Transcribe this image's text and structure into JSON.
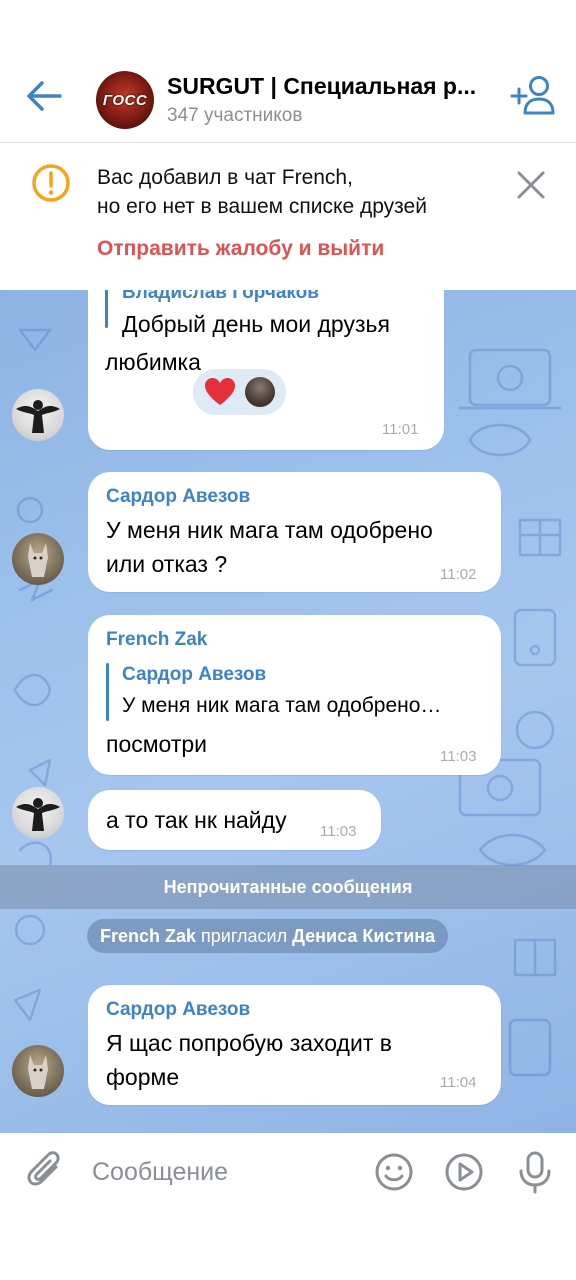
{
  "header": {
    "title": "SURGUT | Специальная р...",
    "subtitle": "347 участников",
    "avatar_text": "ГОСС"
  },
  "notice": {
    "line1": "Вас добавил в чат French,",
    "line2": "но его нет в вашем списке друзей",
    "action": "Отправить жалобу и выйти"
  },
  "messages": [
    {
      "quote_name": "Владислав Горчаков",
      "text_line1": "Добрый день мои друзья",
      "text_line2": "любимка",
      "reaction": "heart",
      "time": "11:01"
    },
    {
      "sender": "Сардор Авезов",
      "text_line1": "У меня ник мага там одобрено",
      "text_line2": "или отказ ?",
      "time": "11:02"
    },
    {
      "sender": "French Zak",
      "quote_name": "Сардор Авезов",
      "quote_text": "У меня ник мага там одобрено…",
      "text": "посмотри",
      "time": "11:03"
    },
    {
      "text": "а то так нк найду",
      "time": "11:03"
    },
    {
      "sender": "Сардор Авезов",
      "text_line1": "Я щас попробую заходит в",
      "text_line2": "форме",
      "time": "11:04"
    }
  ],
  "unread_label": "Непрочитанные сообщения",
  "service": {
    "actor": "French Zak",
    "action": "пригласил",
    "target": "Дениса Кистина"
  },
  "input": {
    "placeholder": "Сообщение"
  },
  "colors": {
    "accent": "#3d83c7",
    "danger": "#e05252",
    "warning": "#f4a51c"
  }
}
